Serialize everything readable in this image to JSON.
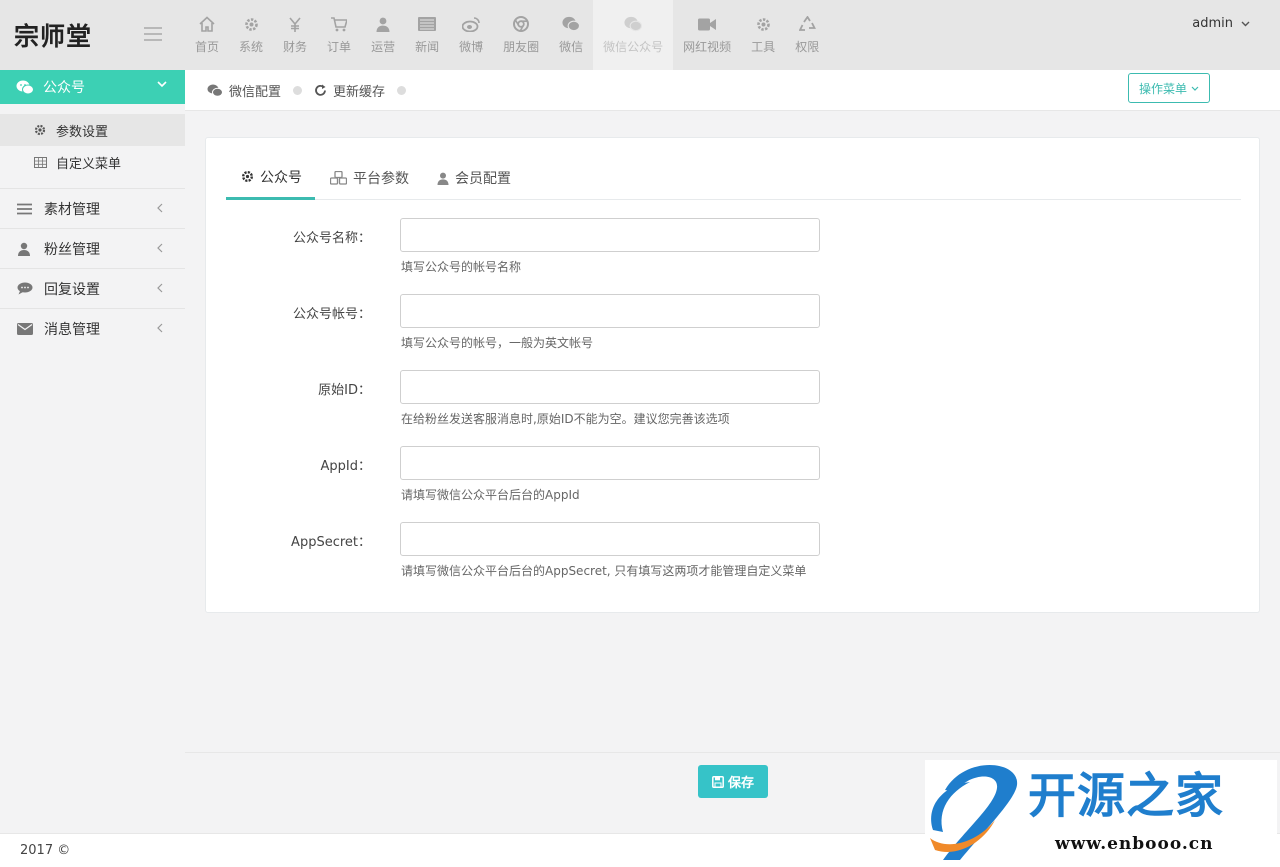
{
  "app": {
    "logo": "宗师堂"
  },
  "nav": [
    {
      "label": "首页",
      "icon": "home-icon"
    },
    {
      "label": "系统",
      "icon": "gear-icon"
    },
    {
      "label": "财务",
      "icon": "yen-icon"
    },
    {
      "label": "订单",
      "icon": "cart-icon"
    },
    {
      "label": "运营",
      "icon": "user-icon"
    },
    {
      "label": "新闻",
      "icon": "news-icon"
    },
    {
      "label": "微博",
      "icon": "weibo-icon"
    },
    {
      "label": "朋友圈",
      "icon": "chrome-icon"
    },
    {
      "label": "微信",
      "icon": "wechat-icon"
    },
    {
      "label": "微信公众号",
      "icon": "wechat-icon",
      "active": true
    },
    {
      "label": "网红视频",
      "icon": "video-icon"
    },
    {
      "label": "工具",
      "icon": "gear-icon"
    },
    {
      "label": "权限",
      "icon": "recycle-icon"
    }
  ],
  "user": {
    "name": "admin"
  },
  "sidebar": {
    "head": "公众号",
    "sub_items": [
      {
        "label": "参数设置",
        "icon": "gear-icon",
        "active": true
      },
      {
        "label": "自定义菜单",
        "icon": "table-icon"
      }
    ],
    "items": [
      {
        "label": "素材管理",
        "icon": "list-icon"
      },
      {
        "label": "粉丝管理",
        "icon": "user-icon"
      },
      {
        "label": "回复设置",
        "icon": "comment-icon"
      },
      {
        "label": "消息管理",
        "icon": "envelope-icon"
      }
    ]
  },
  "breadcrumb": {
    "item1": "微信配置",
    "item2": "更新缓存",
    "op_menu": "操作菜单"
  },
  "tabs": [
    {
      "label": "公众号",
      "icon": "gear-icon",
      "active": true
    },
    {
      "label": "平台参数",
      "icon": "cubes-icon"
    },
    {
      "label": "会员配置",
      "icon": "user-icon"
    }
  ],
  "form": [
    {
      "label": "公众号名称：",
      "value": "",
      "help": "填写公众号的帐号名称"
    },
    {
      "label": "公众号帐号：",
      "value": "",
      "help": "填写公众号的帐号，一般为英文帐号"
    },
    {
      "label": "原始ID：",
      "value": "",
      "help": "在给粉丝发送客服消息时,原始ID不能为空。建议您完善该选项"
    },
    {
      "label": "AppId：",
      "value": "",
      "help": "请填写微信公众平台后台的AppId"
    },
    {
      "label": "AppSecret：",
      "value": "",
      "help": "请填写微信公众平台后台的AppSecret, 只有填写这两项才能管理自定义菜单"
    }
  ],
  "actions": {
    "save": "保存"
  },
  "footer": {
    "copyright": "2017 ©"
  },
  "watermark": {
    "text": "开源之家",
    "url": "www.enbooo.cn"
  },
  "colors": {
    "accent": "#3cd0b4",
    "save": "#36c3c8",
    "brand_blue": "#1f7ecd",
    "logo_accent": "#e8642c"
  }
}
